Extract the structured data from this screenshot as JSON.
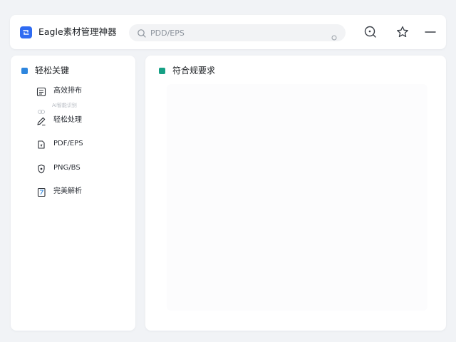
{
  "app": {
    "title": "Eagle素材管理神器"
  },
  "search": {
    "value": "",
    "placeholder": "PDD/EPS"
  },
  "toolbar": {
    "buttons": [
      {
        "icon": "zoom-search-icon"
      },
      {
        "icon": "star-icon"
      },
      {
        "icon": "minimize-icon"
      }
    ]
  },
  "sidebar": {
    "section_title": "轻松关键",
    "sub_caption": "AI智能识别",
    "items": [
      {
        "label": "高效排布",
        "icon": "list-icon"
      },
      {
        "label": "轻松处理",
        "icon": "edit-icon"
      },
      {
        "label": "PDF/EPS",
        "icon": "document-icon"
      },
      {
        "label": "PNG/BS",
        "icon": "shield-icon"
      },
      {
        "label": "完美解析",
        "icon": "book-icon"
      }
    ]
  },
  "main": {
    "section_title": "符合规要求"
  },
  "colors": {
    "accent": "#2f6bf2",
    "sidebar_section_icon": "#2e86de",
    "main_section_icon": "#16a085",
    "background": "#f1f3f6"
  }
}
